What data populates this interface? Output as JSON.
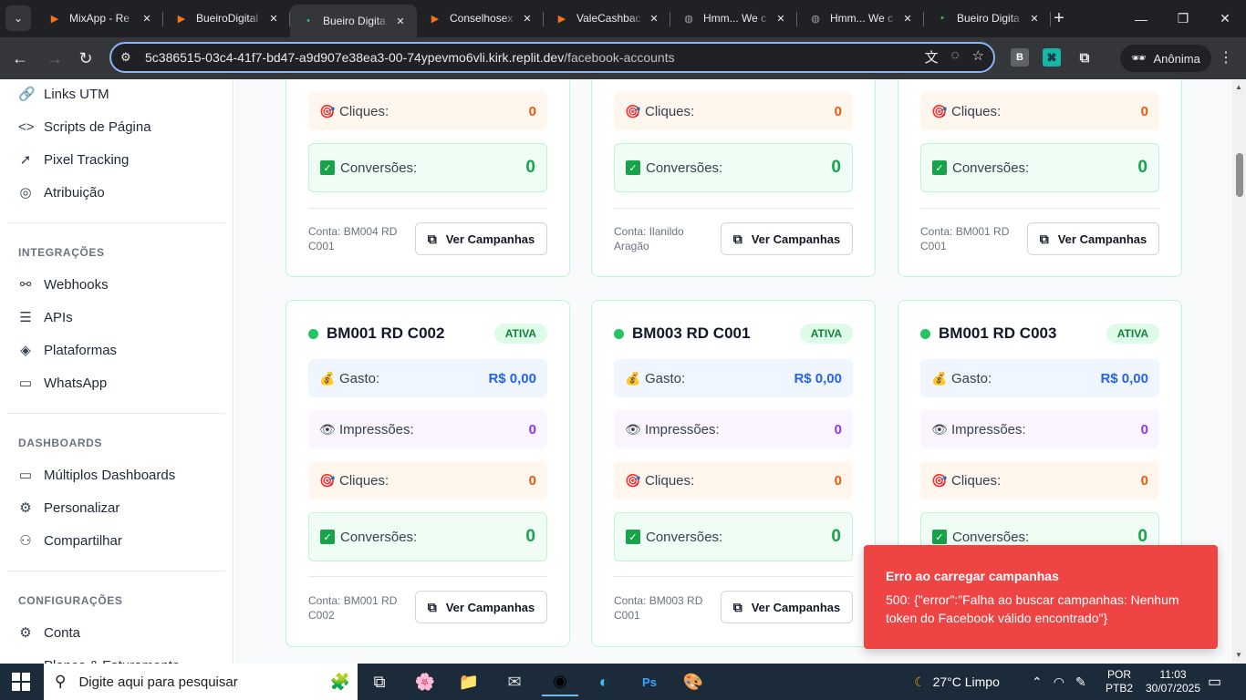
{
  "browser": {
    "tabs": [
      {
        "title": "MixApp - Re",
        "fav_color": "#f97316",
        "fav": "▶"
      },
      {
        "title": "BueiroDigital",
        "fav_color": "#f97316",
        "fav": "▶"
      },
      {
        "title": "Bueiro Digita",
        "fav_color": "#22c55e",
        "fav": "•",
        "active": true
      },
      {
        "title": "Conselhosex",
        "fav_color": "#f97316",
        "fav": "▶"
      },
      {
        "title": "ValeCashbac",
        "fav_color": "#f97316",
        "fav": "▶"
      },
      {
        "title": "Hmm... We c",
        "fav_color": "#9aa0a6",
        "fav": "◍"
      },
      {
        "title": "Hmm... We c",
        "fav_color": "#9aa0a6",
        "fav": "◍"
      },
      {
        "title": "Bueiro Digita",
        "fav_color": "#22c55e",
        "fav": "•"
      }
    ],
    "url_host": "5c386515-03c4-41f7-bd47-a9d907e38ea3-00-74ypevmo6vli.kirk.replit.dev",
    "url_path": "/facebook-accounts",
    "profile_label": "Anônima",
    "ext_b": "B"
  },
  "sidebar": {
    "top_items": [
      {
        "label": "Links UTM",
        "icon": "link-icon",
        "glyph": "🔗"
      },
      {
        "label": "Scripts de Página",
        "icon": "code-icon",
        "glyph": "<>"
      },
      {
        "label": "Pixel Tracking",
        "icon": "cursor-icon",
        "glyph": "➚"
      },
      {
        "label": "Atribuição",
        "icon": "target-icon",
        "glyph": "◎"
      }
    ],
    "integracoes_heading": "INTEGRAÇÕES",
    "integracoes": [
      {
        "label": "Webhooks",
        "icon": "webhook-icon",
        "glyph": "⚯"
      },
      {
        "label": "APIs",
        "icon": "database-icon",
        "glyph": "☰"
      },
      {
        "label": "Plataformas",
        "icon": "layers-icon",
        "glyph": "◈"
      },
      {
        "label": "WhatsApp",
        "icon": "message-icon",
        "glyph": "▭"
      }
    ],
    "dashboards_heading": "DASHBOARDS",
    "dashboards": [
      {
        "label": "Múltiplos Dashboards",
        "icon": "monitor-icon",
        "glyph": "▭"
      },
      {
        "label": "Personalizar",
        "icon": "gear-icon",
        "glyph": "⚙"
      },
      {
        "label": "Compartilhar",
        "icon": "users-icon",
        "glyph": "⚇"
      }
    ],
    "config_heading": "CONFIGURAÇÕES",
    "config": [
      {
        "label": "Conta",
        "icon": "gear-icon",
        "glyph": "⚙"
      },
      {
        "label": "Planos & Faturamento",
        "icon": "card-icon",
        "glyph": "▭"
      }
    ]
  },
  "labels": {
    "gasto": "Gasto:",
    "impressoes": "Impressões:",
    "cliques": "Cliques:",
    "conversoes": "Conversões:",
    "ver_campanhas": "Ver Campanhas",
    "status": "ATIVA"
  },
  "top_cards": [
    {
      "cliques": "0",
      "conversoes": "0",
      "conta": "Conta: BM004 RD C001"
    },
    {
      "cliques": "0",
      "conversoes": "0",
      "conta": "Conta: Ilanildo Aragão"
    },
    {
      "cliques": "0",
      "conversoes": "0",
      "conta": "Conta: BM001 RD C001"
    }
  ],
  "cards": [
    {
      "name": "BM001 RD C002",
      "gasto": "R$ 0,00",
      "impressoes": "0",
      "cliques": "0",
      "conversoes": "0",
      "conta": "Conta: BM001 RD C002"
    },
    {
      "name": "BM003 RD C001",
      "gasto": "R$ 0,00",
      "impressoes": "0",
      "cliques": "0",
      "conversoes": "0",
      "conta": "Conta: BM003 RD C001"
    },
    {
      "name": "BM001 RD C003",
      "gasto": "R$ 0,00",
      "impressoes": "0",
      "cliques": "0",
      "conversoes": "0",
      "conta": ""
    }
  ],
  "toast": {
    "title": "Erro ao carregar campanhas",
    "message": "500: {\"error\":\"Falha ao buscar campanhas: Nenhum token do Facebook válido encontrado\"}"
  },
  "taskbar": {
    "search_placeholder": "Digite aqui para pesquisar",
    "weather": "27°C  Limpo",
    "lang1": "POR",
    "lang2": "PTB2",
    "time": "11:03",
    "date": "30/07/2025"
  }
}
